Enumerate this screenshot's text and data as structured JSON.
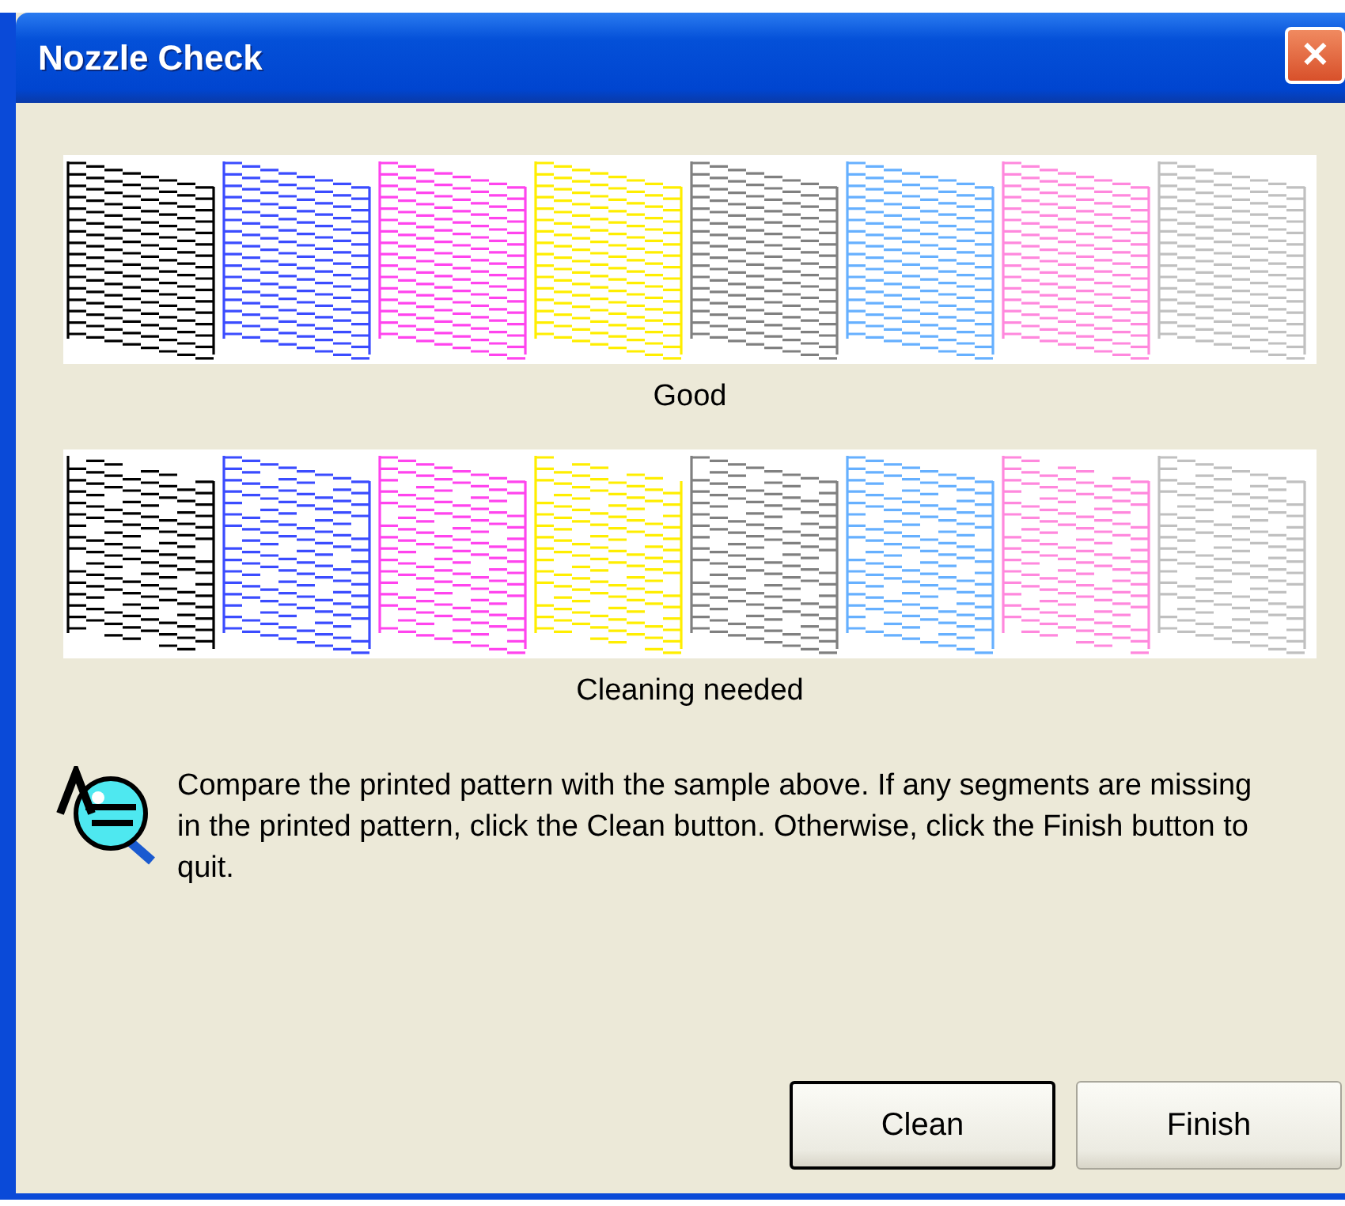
{
  "window": {
    "title": "Nozzle Check",
    "close": "✕"
  },
  "inks": [
    {
      "color": "#000000"
    },
    {
      "color": "#3b4cff"
    },
    {
      "color": "#ff44ee"
    },
    {
      "color": "#ffee00"
    },
    {
      "color": "#808080"
    },
    {
      "color": "#66b0ff"
    },
    {
      "color": "#ff88dd"
    },
    {
      "color": "#c0c0c0"
    }
  ],
  "samples": [
    {
      "caption": "Good",
      "kind": "good"
    },
    {
      "caption": "Cleaning needed",
      "kind": "missing"
    }
  ],
  "message": "Compare the printed pattern with the sample above. If any segments are missing in the printed pattern, click the Clean button. Otherwise, click the Finish button to quit.",
  "buttons": [
    {
      "label": "Clean",
      "default": true
    },
    {
      "label": "Finish",
      "default": false
    }
  ]
}
